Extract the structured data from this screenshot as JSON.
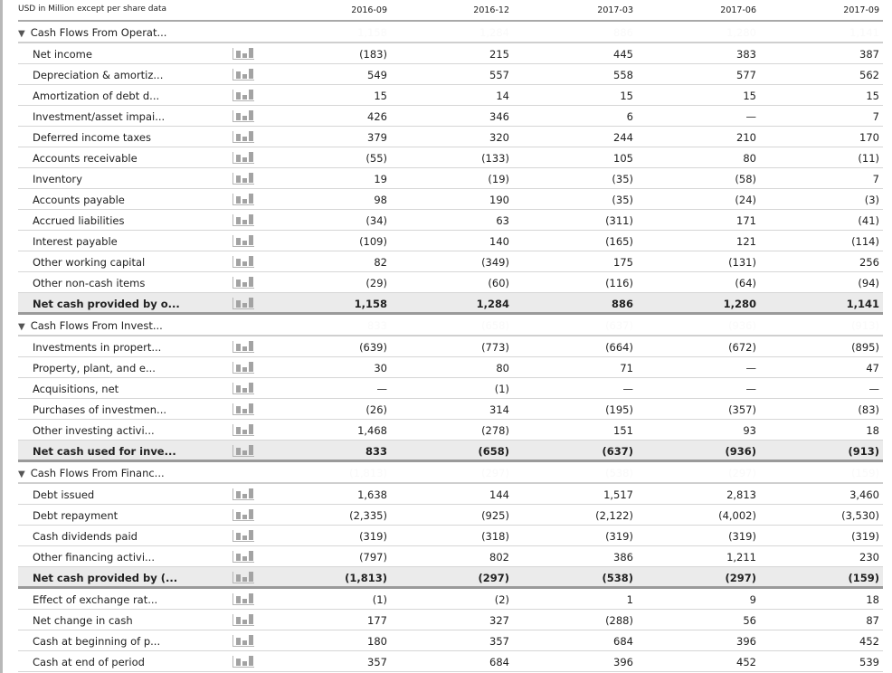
{
  "header": {
    "units_label": "USD in Million except per share data",
    "periods": [
      "2016-09",
      "2016-12",
      "2017-03",
      "2017-06",
      "2017-09"
    ]
  },
  "sections": [
    {
      "title": "Cash Flows From Operat...",
      "hidden_values": [
        "1,158",
        "1,284",
        "886",
        "1,280",
        "1,141"
      ],
      "rows": [
        {
          "label": "Net income",
          "values": [
            "(183)",
            "215",
            "445",
            "383",
            "387"
          ]
        },
        {
          "label": "Depreciation & amortiz...",
          "values": [
            "549",
            "557",
            "558",
            "577",
            "562"
          ]
        },
        {
          "label": "Amortization of debt d...",
          "values": [
            "15",
            "14",
            "15",
            "15",
            "15"
          ]
        },
        {
          "label": "Investment/asset impai...",
          "values": [
            "426",
            "346",
            "6",
            "—",
            "7"
          ]
        },
        {
          "label": "Deferred income taxes",
          "values": [
            "379",
            "320",
            "244",
            "210",
            "170"
          ]
        },
        {
          "label": "Accounts receivable",
          "values": [
            "(55)",
            "(133)",
            "105",
            "80",
            "(11)"
          ]
        },
        {
          "label": "Inventory",
          "values": [
            "19",
            "(19)",
            "(35)",
            "(58)",
            "7"
          ]
        },
        {
          "label": "Accounts payable",
          "values": [
            "98",
            "190",
            "(35)",
            "(24)",
            "(3)"
          ]
        },
        {
          "label": "Accrued liabilities",
          "values": [
            "(34)",
            "63",
            "(311)",
            "171",
            "(41)"
          ]
        },
        {
          "label": "Interest payable",
          "values": [
            "(109)",
            "140",
            "(165)",
            "121",
            "(114)"
          ]
        },
        {
          "label": "Other working capital",
          "values": [
            "82",
            "(349)",
            "175",
            "(131)",
            "256"
          ]
        },
        {
          "label": "Other non-cash items",
          "values": [
            "(29)",
            "(60)",
            "(116)",
            "(64)",
            "(94)"
          ]
        }
      ],
      "total": {
        "label": "Net cash provided by o...",
        "values": [
          "1,158",
          "1,284",
          "886",
          "1,280",
          "1,141"
        ]
      }
    },
    {
      "title": "Cash Flows From Invest...",
      "hidden_values": [
        "833",
        "(658)",
        "(637)",
        "(936)",
        "(913)"
      ],
      "rows": [
        {
          "label": "Investments in propert...",
          "values": [
            "(639)",
            "(773)",
            "(664)",
            "(672)",
            "(895)"
          ]
        },
        {
          "label": "Property, plant, and e...",
          "values": [
            "30",
            "80",
            "71",
            "—",
            "47"
          ]
        },
        {
          "label": "Acquisitions, net",
          "values": [
            "—",
            "(1)",
            "—",
            "—",
            "—"
          ]
        },
        {
          "label": "Purchases of investmen...",
          "values": [
            "(26)",
            "314",
            "(195)",
            "(357)",
            "(83)"
          ]
        },
        {
          "label": "Other investing activi...",
          "values": [
            "1,468",
            "(278)",
            "151",
            "93",
            "18"
          ]
        }
      ],
      "total": {
        "label": "Net cash used for inve...",
        "values": [
          "833",
          "(658)",
          "(637)",
          "(936)",
          "(913)"
        ]
      }
    },
    {
      "title": "Cash Flows From Financ...",
      "hidden_values": [
        "(1,813)",
        "(297)",
        "(538)",
        "(297)",
        "(159)"
      ],
      "rows": [
        {
          "label": "Debt issued",
          "values": [
            "1,638",
            "144",
            "1,517",
            "2,813",
            "3,460"
          ]
        },
        {
          "label": "Debt repayment",
          "values": [
            "(2,335)",
            "(925)",
            "(2,122)",
            "(4,002)",
            "(3,530)"
          ]
        },
        {
          "label": "Cash dividends paid",
          "values": [
            "(319)",
            "(318)",
            "(319)",
            "(319)",
            "(319)"
          ]
        },
        {
          "label": "Other financing activi...",
          "values": [
            "(797)",
            "802",
            "386",
            "1,211",
            "230"
          ]
        }
      ],
      "total": {
        "label": "Net cash provided by (...",
        "values": [
          "(1,813)",
          "(297)",
          "(538)",
          "(297)",
          "(159)"
        ]
      }
    }
  ],
  "footer_rows": [
    {
      "label": "Effect of exchange rat...",
      "values": [
        "(1)",
        "(2)",
        "1",
        "9",
        "18"
      ]
    },
    {
      "label": "Net change in cash",
      "values": [
        "177",
        "327",
        "(288)",
        "56",
        "87"
      ]
    },
    {
      "label": "Cash at beginning of p...",
      "values": [
        "180",
        "357",
        "684",
        "396",
        "452"
      ]
    },
    {
      "label": "Cash at end of period",
      "values": [
        "357",
        "684",
        "396",
        "452",
        "539"
      ]
    }
  ],
  "icons": {
    "section_toggle": "collapse-triangle-icon",
    "row_chart": "bar-chart-icon"
  }
}
